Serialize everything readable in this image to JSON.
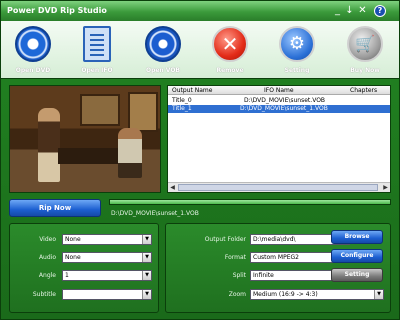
{
  "app": {
    "title": "Power DVD Rip Studio"
  },
  "titlebar": {
    "minimize": "_",
    "restore": "↓",
    "close": "✕",
    "help": "?"
  },
  "toolbar": {
    "items": [
      {
        "id": "open_dvd",
        "label": "Open DVD",
        "icon": "disc-icon"
      },
      {
        "id": "open_ifo",
        "label": "Open IFO",
        "icon": "document-icon"
      },
      {
        "id": "open_vob",
        "label": "Open VOB",
        "icon": "disc-icon"
      },
      {
        "id": "remove",
        "label": "Remove",
        "icon": "remove-icon"
      },
      {
        "id": "setting",
        "label": "Setting",
        "icon": "wrench-icon"
      },
      {
        "id": "buy_now",
        "label": "Buy Now",
        "icon": "cart-icon"
      }
    ]
  },
  "list": {
    "columns": [
      "Output Name",
      "IFO Name",
      "Chapters"
    ],
    "rows": [
      {
        "output": "Title_0",
        "ifo": "D:\\DVD_MOVIE\\sunset.VOB",
        "selected": false
      },
      {
        "output": "Title_1",
        "ifo": "D:\\DVD_MOVIE\\sunset_1.VOB",
        "selected": true
      }
    ]
  },
  "rip": {
    "button": "Rip Now",
    "path": "D:\\DVD_MOVIE\\sunset_1.VOB",
    "progress_percent": 100
  },
  "left_panel": {
    "video_label": "Video",
    "video_value": "None",
    "audio_label": "Audio",
    "audio_value": "None",
    "angle_label": "Angle",
    "angle_value": "1",
    "subtitle_label": "Subtitle",
    "subtitle_value": ""
  },
  "right_panel": {
    "output_folder_label": "Output Folder",
    "output_folder_value": "D:\\media\\dvd\\",
    "format_label": "Format",
    "format_value": "Custom MPEG2",
    "split_label": "Split",
    "split_value": "Infinite",
    "zoom_label": "Zoom",
    "zoom_value": "Medium (16:9 -> 4:3)",
    "browse": "Browse",
    "configure": "Configure",
    "setting": "Setting"
  },
  "colors": {
    "accent_blue": "#1d5fd1",
    "window_green": "#228522",
    "selection": "#2f6fd1"
  }
}
